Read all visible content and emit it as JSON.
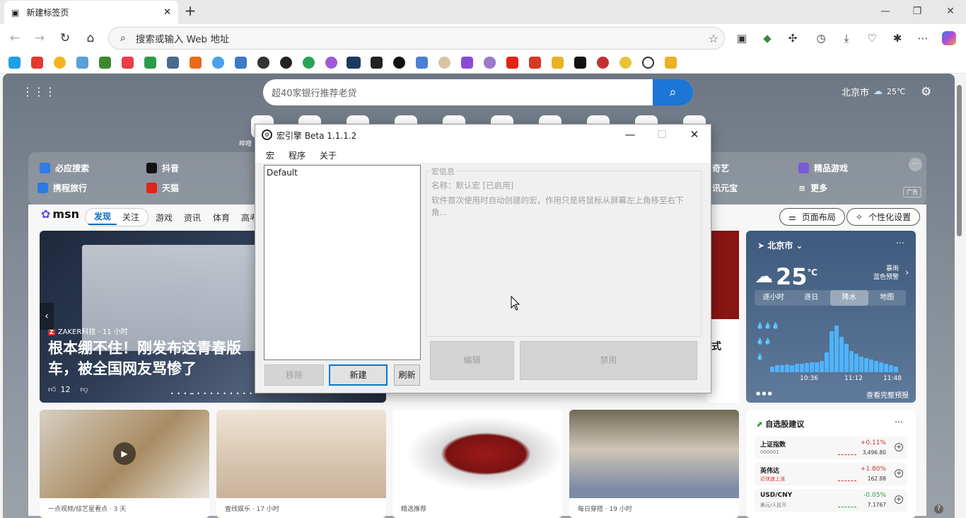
{
  "browser": {
    "tab_title": "新建标签页",
    "address_placeholder": "搜索或输入 Web 地址"
  },
  "newtab": {
    "search_placeholder": "超40家银行推荐老贷",
    "weather_city": "北京市",
    "weather_temp": "25℃",
    "quick_links": [
      "必应搜索",
      "抖音",
      "携程旅行",
      "天猫",
      "奇艺",
      "精品游戏",
      "讯元宝",
      "更多"
    ],
    "tile_caption": "哔哩",
    "ad_label": "广告"
  },
  "feed": {
    "logo": "msn",
    "tabs": [
      "发现",
      "关注"
    ],
    "tabs_more": [
      "游戏",
      "资讯",
      "体育",
      "高考"
    ],
    "layout_button": "页面布局",
    "personalize_button": "个性化设置",
    "hero": {
      "source": "ZAKER科技 · 11 小时",
      "headline": "根本绷不住！刚发布这青春版车，被全国网友骂惨了",
      "likes": "12"
    },
    "side_news_text": "式",
    "cards": [
      {
        "caption": "一点视频/综艺星看点 · 3 天"
      },
      {
        "caption": "壹线娱乐 · 17 小时"
      },
      {
        "caption": "精选推荐"
      },
      {
        "caption": "每日穿搭 · 19 小时"
      }
    ]
  },
  "weather_card": {
    "city": "北京市",
    "temp": "25",
    "unit": "℃",
    "alert_line1": "暴雨",
    "alert_line2": "蓝色预警",
    "tabs": [
      "逐小时",
      "逐日",
      "降水",
      "地图"
    ],
    "active_tab": "降水",
    "time_labels": [
      "10:36",
      "11:12",
      "11:48"
    ],
    "full_report": "查看完整预报"
  },
  "stocks": {
    "title": "自选股建议",
    "rows": [
      {
        "name": "上证指数",
        "sub": "000001",
        "pct": "+0.11%",
        "value": "3,496.80"
      },
      {
        "name": "英伟达",
        "sub": "近快速上涨",
        "pct": "+1.80%",
        "value": "162.88"
      },
      {
        "name": "USD/CNY",
        "sub": "美元/人民币",
        "pct": "-0.05%",
        "value": "7.1767"
      }
    ]
  },
  "dialog": {
    "title": "宏引擎 Beta 1.1.1.2",
    "menu": [
      "宏",
      "程序",
      "关于"
    ],
    "list_items": [
      "Default"
    ],
    "btn_remove": "移除",
    "btn_new": "新建",
    "btn_refresh": "刷新",
    "group_label": "宏信息",
    "name_line": "名称：默认宏 [已启用]",
    "desc_line": "软件首次使用时自动创建的宏，作用只是将鼠标从屏幕左上角移至右下角...",
    "btn_edit": "编辑",
    "btn_disable": "禁用"
  }
}
